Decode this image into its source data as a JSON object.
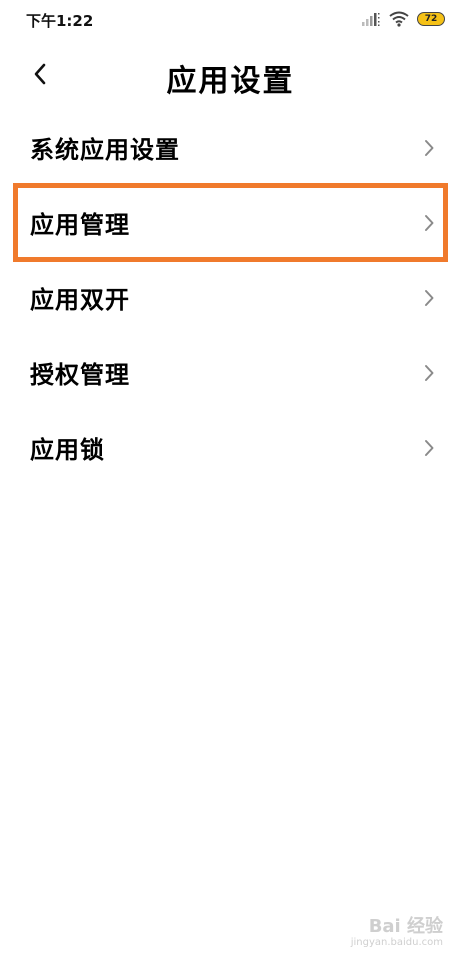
{
  "status_bar": {
    "time": "下午1:22",
    "battery_level": "72",
    "signal_icon": "signal-bars-icon",
    "wifi_icon": "wifi-icon"
  },
  "header": {
    "title": "应用设置",
    "back_icon": "chevron-left-icon"
  },
  "menu": {
    "items": [
      {
        "label": "系统应用设置"
      },
      {
        "label": "应用管理"
      },
      {
        "label": "应用双开"
      },
      {
        "label": "授权管理"
      },
      {
        "label": "应用锁"
      }
    ]
  },
  "highlight": {
    "item_index": 1,
    "color": "#f07a2c"
  },
  "watermark": {
    "brand": "Bai 经验",
    "url": "jingyan.baidu.com"
  },
  "colors": {
    "background": "#ffffff",
    "text": "#000000",
    "chevron": "#8a8a8a",
    "battery_fill": "#f5c116"
  }
}
